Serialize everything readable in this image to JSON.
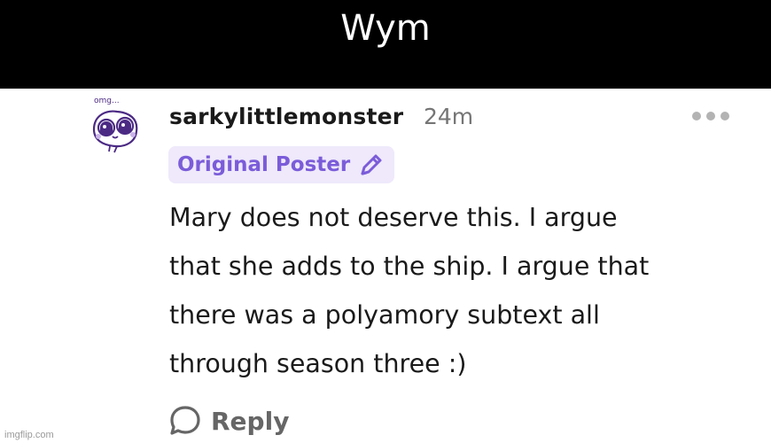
{
  "caption": {
    "text": "Wym"
  },
  "comment": {
    "avatar_caption": "omg...",
    "username": "sarkylittlemonster",
    "timestamp": "24m",
    "badge": {
      "label": "Original Poster",
      "icon": "pencil-icon"
    },
    "body_lines": [
      "Mary does not deserve this. I argue",
      "that she adds to the ship. I argue that",
      "there was a polyamory subtext all",
      "through season three :)"
    ],
    "more_icon": "more-dots-icon",
    "reply": {
      "label": "Reply",
      "icon": "speech-bubble-icon"
    }
  },
  "watermark": {
    "text": "imgflip.com"
  },
  "colors": {
    "caption_bg": "#000000",
    "caption_text": "#ffffff",
    "badge_bg": "#efe9fb",
    "badge_text": "#7b5cd9",
    "avatar_purple": "#4b2a84",
    "timestamp_gray": "#757575",
    "reply_gray": "#666666"
  }
}
